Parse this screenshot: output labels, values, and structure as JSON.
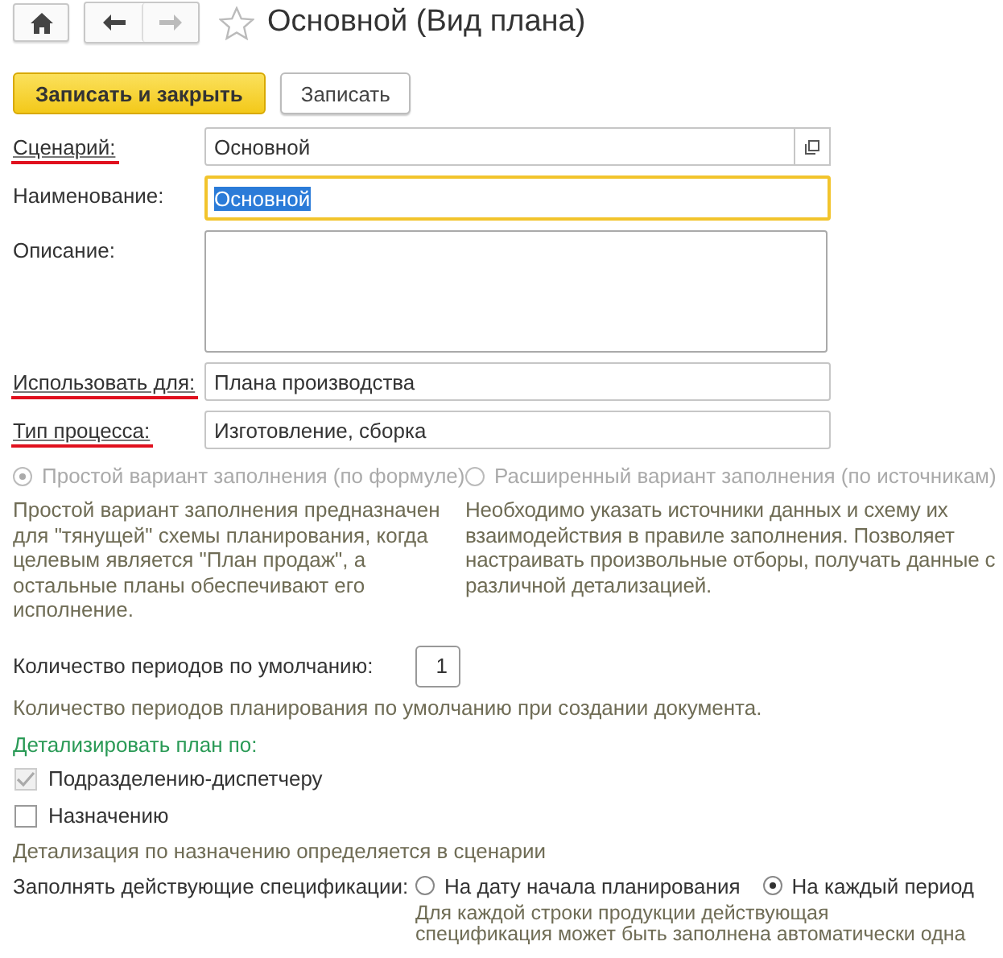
{
  "toolbar": {
    "title": "Основной (Вид плана)",
    "favorite": false
  },
  "actions": [
    {
      "label": "Записать и закрыть",
      "kind": "primary"
    },
    {
      "label": "Записать",
      "kind": "secondary"
    }
  ],
  "fields": [
    {
      "label": "Сценарий:",
      "value": "Основной",
      "kind": "select",
      "underlined": true,
      "focused": false
    },
    {
      "label": "Наименование:",
      "value": "Основной",
      "kind": "text",
      "underlined": false,
      "focused": true
    },
    {
      "label": "Описание:",
      "kind": "textarea",
      "underlined": false,
      "focused": false
    },
    {
      "label": "Использовать для:",
      "value": "Плана производства",
      "kind": "text",
      "underlined": true,
      "focused": false
    },
    {
      "label": "Тип процесса:",
      "value": "Изготовление, сборка",
      "kind": "text",
      "underlined": true,
      "focused": false
    }
  ],
  "fill_variant": {
    "disabled": true,
    "options": [
      {
        "label": "Простой вариант заполнения (по формуле)",
        "selected": true,
        "description": "Простой вариант заполнения предназначен для \"тянущей\" схемы планирования, когда целевым является \"План продаж\", а остальные планы обеспечивают его исполнение."
      },
      {
        "label": "Расширенный вариант заполнения (по источникам)",
        "selected": false,
        "description": "Необходимо указать источники данных и схему их взаимодействия в правиле заполнения. Позволяет настраивать произвольные отборы, получать данные с различной детализацией."
      }
    ]
  },
  "periods": {
    "label": "Количество периодов по умолчанию:",
    "value": "1",
    "hint": "Количество периодов планирования по умолчанию при создании документа."
  },
  "detail": {
    "heading": "Детализировать план по:",
    "options": [
      {
        "label": "Подразделению-диспетчеру",
        "checked": true,
        "disabled": true
      },
      {
        "label": "Назначению",
        "checked": false,
        "disabled": false
      }
    ],
    "hint": "Детализация по назначению определяется в сценарии"
  },
  "specs": {
    "label": "Заполнять действующие спецификации:",
    "options": [
      {
        "label": "На дату начала планирования",
        "selected": false
      },
      {
        "label": "На каждый период",
        "selected": true
      }
    ],
    "hint": "Для каждой строки продукции действующая спецификация может быть заполнена автоматически одна"
  }
}
